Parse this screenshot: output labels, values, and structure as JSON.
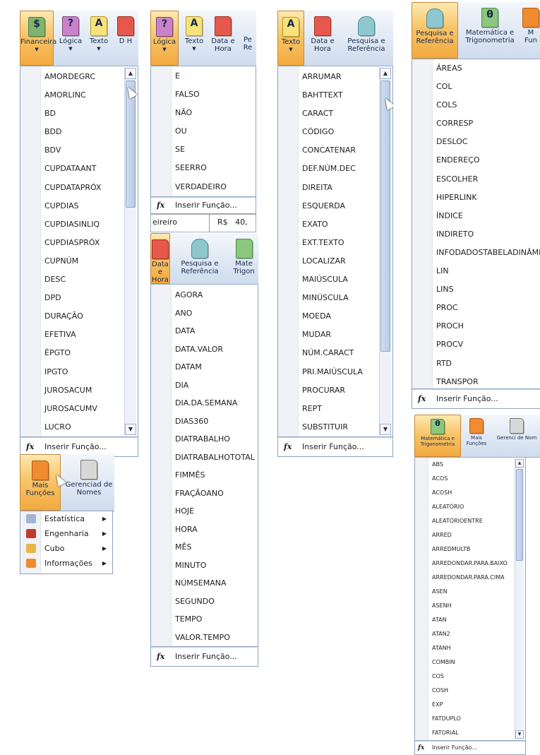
{
  "panel1": {
    "tabs": [
      "Financeira",
      "Lógica",
      "Texto",
      "D H"
    ],
    "items": [
      "AMORDEGRC",
      "AMORLINC",
      "BD",
      "BDD",
      "BDV",
      "CUPDATAANT",
      "CUPDATAPRÓX",
      "CUPDIAS",
      "CUPDIASINLIQ",
      "CUPDIASPRÓX",
      "CUPNÚM",
      "DESC",
      "DPD",
      "DURAÇÃO",
      "EFETIVA",
      "ÉPGTO",
      "IPGTO",
      "JUROSACUM",
      "JUROSACUMV",
      "LUCRO"
    ],
    "footer": "Inserir Função..."
  },
  "panel2": {
    "tabs": [
      "Lógica",
      "Texto",
      "Data e Hora",
      "Pe Re"
    ],
    "items": [
      "E",
      "FALSO",
      "NÃO",
      "OU",
      "SE",
      "SEERRO",
      "VERDADEIRO"
    ],
    "footer": "Inserir Função...",
    "sheet_cell": "eireiro",
    "sheet_value": "R$   40,"
  },
  "panel3": {
    "tabs": [
      "Texto",
      "Data e Hora",
      "Pesquisa e Referência"
    ],
    "items": [
      "ARRUMAR",
      "BAHTTEXT",
      "CARACT",
      "CÓDIGO",
      "CONCATENAR",
      "DEF.NÚM.DEC",
      "DIREITA",
      "ESQUERDA",
      "EXATO",
      "EXT.TEXTO",
      "LOCALIZAR",
      "MAIÚSCULA",
      "MINÚSCULA",
      "MOEDA",
      "MUDAR",
      "NÚM.CARACT",
      "PRI.MAIÚSCULA",
      "PROCURAR",
      "REPT",
      "SUBSTITUIR"
    ],
    "footer": "Inserir Função..."
  },
  "panel4": {
    "tabs": [
      "Pesquisa e Referência",
      "Matemática e Trigonometria",
      "M Fun"
    ],
    "items": [
      "ÁREAS",
      "COL",
      "COLS",
      "CORRESP",
      "DESLOC",
      "ENDEREÇO",
      "ESCOLHER",
      "HIPERLINK",
      "ÍNDICE",
      "INDIRETO",
      "INFODADOSTABELADINÂMI",
      "LIN",
      "LINS",
      "PROC",
      "PROCH",
      "PROCV",
      "RTD",
      "TRANSPOR"
    ],
    "footer": "Inserir Função..."
  },
  "panel5": {
    "tabs": [
      "Mais Funções",
      "Gerenciad de Nomes"
    ],
    "items": [
      "Estatística",
      "Engenharia",
      "Cubo",
      "Informações"
    ]
  },
  "panel6": {
    "tabs": [
      "Data e Hora",
      "Pesquisa e Referência",
      "Mate Trigon"
    ],
    "items": [
      "AGORA",
      "ANO",
      "DATA",
      "DATA.VALOR",
      "DATAM",
      "DIA",
      "DIA.DA.SEMANA",
      "DIAS360",
      "DIATRABALHO",
      "DIATRABALHOTOTAL",
      "FIMMÊS",
      "FRAÇÃOANO",
      "HOJE",
      "HORA",
      "MÊS",
      "MINUTO",
      "NÚMSEMANA",
      "SEGUNDO",
      "TEMPO",
      "VALOR.TEMPO"
    ],
    "footer": "Inserir Função..."
  },
  "panel7": {
    "tabs": [
      "Matemática e Trigonometria",
      "Mais Funções",
      "Gerenci de Nom"
    ],
    "items": [
      "ABS",
      "ACOS",
      "ACOSH",
      "ALEATÓRIO",
      "ALEATÓRIOENTRE",
      "ARRED",
      "ARREDMULTB",
      "ARREDONDAR.PARA.BAIXO",
      "ARREDONDAR.PARA.CIMA",
      "ASEN",
      "ASENH",
      "ATAN",
      "ATAN2",
      "ATANH",
      "COMBIN",
      "COS",
      "COSH",
      "EXP",
      "FATDUPLO",
      "FATORIAL"
    ],
    "footer": "Inserir Função..."
  },
  "icons": {
    "fx": "fx-icon",
    "scroll_up": "scroll-up-arrow-icon",
    "scroll_down": "scroll-down-arrow-icon"
  },
  "colors": {
    "active_tab": "#f8c56a",
    "list_border": "#8ea4c0",
    "ribbon": "#dfe8f4"
  }
}
